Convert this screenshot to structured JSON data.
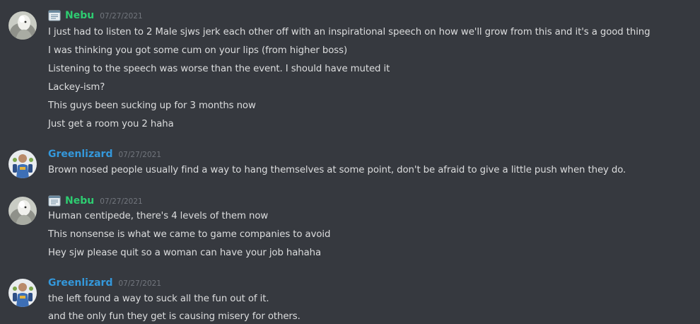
{
  "messages": [
    {
      "author": "Nebu",
      "timestamp": "07/27/2021",
      "author_color": "#2ecc71",
      "role_icon": "notepad-icon",
      "lines": [
        "I just had to listen to 2 Male sjws jerk each other off with an inspirational speech on how we'll grow from this and it's a good thing",
        "I was thinking you got some cum on your lips (from higher boss)",
        "Listening to the speech was worse than the event. I should have muted it",
        "Lackey-ism?",
        "This guys been sucking up for 3 months now",
        "Just get a room you 2 haha"
      ]
    },
    {
      "author": "Greenlizard",
      "timestamp": "07/27/2021",
      "author_color": "#3498db",
      "lines": [
        "Brown nosed people usually find a way to hang themselves at some point, don't be afraid to give a little push when they do."
      ]
    },
    {
      "author": "Nebu",
      "timestamp": "07/27/2021",
      "author_color": "#2ecc71",
      "role_icon": "notepad-icon",
      "lines": [
        "Human centipede, there's 4 levels of them now",
        "This nonsense is what we came to game companies to avoid",
        "Hey sjw  please quit so a woman can have your job hahaha"
      ]
    },
    {
      "author": "Greenlizard",
      "timestamp": "07/27/2021",
      "author_color": "#3498db",
      "lines": [
        "the left found a way to suck all the fun out of it.",
        "and the only fun they get is causing misery for others."
      ]
    }
  ],
  "colors": {
    "background": "#36393f",
    "text": "#dcddde",
    "timestamp": "#72767d"
  }
}
